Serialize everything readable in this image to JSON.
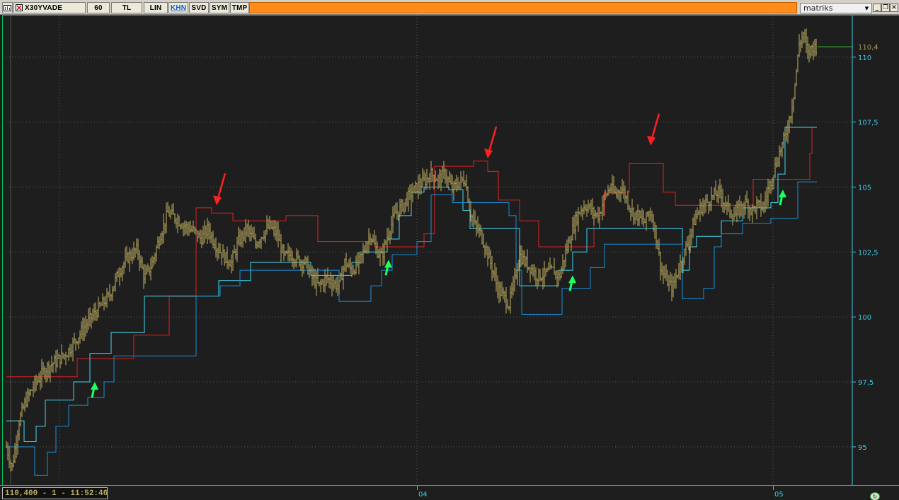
{
  "toolbar": {
    "menu_icon": "chart-menu-icon",
    "symbol": "X30YVADE",
    "period": "60",
    "currency": "TL",
    "scale": "LIN",
    "chart_type": "KHN",
    "svd": "SVD",
    "sym": "SYM",
    "tmp": "TMP",
    "brand": "matriks",
    "accent_color": "#ff8c1a",
    "window_buttons": [
      "dropdown-icon",
      "minimize-icon",
      "restore-icon",
      "close-icon"
    ]
  },
  "chart_data": {
    "type": "candlestick",
    "ylim": [
      93.5,
      111.6
    ],
    "yticks": [
      95,
      97.5,
      100,
      102.5,
      105,
      107.5,
      110
    ],
    "ytick_labels": [
      "95",
      "97,5",
      "100",
      "102,5",
      "105",
      "107,5",
      "110"
    ],
    "x_labels": [
      "04",
      "05"
    ],
    "last_price_label": "110,4",
    "last_price": 110.4,
    "series": [
      {
        "color": "#a89a58",
        "points": [
          [
            0,
            95
          ],
          [
            8,
            94.2
          ],
          [
            18,
            96
          ],
          [
            28,
            96.8
          ],
          [
            40,
            97.4
          ],
          [
            55,
            98
          ],
          [
            70,
            98.3
          ],
          [
            85,
            98.6
          ],
          [
            100,
            99.2
          ],
          [
            115,
            99.8
          ],
          [
            130,
            100.3
          ],
          [
            145,
            100.8
          ],
          [
            160,
            101.8
          ],
          [
            172,
            102.3
          ],
          [
            185,
            102.6
          ],
          [
            195,
            101.5
          ],
          [
            205,
            102
          ],
          [
            218,
            103.2
          ],
          [
            228,
            104
          ],
          [
            240,
            103.8
          ],
          [
            252,
            103.5
          ],
          [
            265,
            103.3
          ],
          [
            275,
            103
          ],
          [
            285,
            103.4
          ],
          [
            295,
            102.8
          ],
          [
            308,
            102.3
          ],
          [
            318,
            102.1
          ],
          [
            328,
            102.9
          ],
          [
            340,
            103.4
          ],
          [
            352,
            102.8
          ],
          [
            362,
            103.2
          ],
          [
            372,
            103.5
          ],
          [
            382,
            103.2
          ],
          [
            392,
            102.3
          ],
          [
            402,
            102.4
          ],
          [
            412,
            102.2
          ],
          [
            422,
            102.1
          ],
          [
            432,
            101.5
          ],
          [
            442,
            101.2
          ],
          [
            452,
            101.5
          ],
          [
            462,
            101.3
          ],
          [
            470,
            101.2
          ],
          [
            478,
            102.1
          ],
          [
            488,
            101.8
          ],
          [
            498,
            102.1
          ],
          [
            506,
            102.6
          ],
          [
            514,
            103.2
          ],
          [
            522,
            102.6
          ],
          [
            530,
            102.3
          ],
          [
            540,
            103.3
          ],
          [
            550,
            104
          ],
          [
            560,
            104.3
          ],
          [
            570,
            104.7
          ],
          [
            580,
            105
          ],
          [
            590,
            105.2
          ],
          [
            600,
            105.5
          ],
          [
            610,
            105.3
          ],
          [
            620,
            105.5
          ],
          [
            630,
            104.9
          ],
          [
            640,
            105.2
          ],
          [
            648,
            105.3
          ],
          [
            655,
            104.1
          ],
          [
            662,
            103.5
          ],
          [
            670,
            103.2
          ],
          [
            678,
            102.6
          ],
          [
            686,
            101.9
          ],
          [
            694,
            101.1
          ],
          [
            702,
            100.8
          ],
          [
            710,
            100.5
          ],
          [
            718,
            101.4
          ],
          [
            725,
            102.4
          ],
          [
            733,
            102.1
          ],
          [
            741,
            101.9
          ],
          [
            749,
            101.6
          ],
          [
            757,
            101.6
          ],
          [
            765,
            101.7
          ],
          [
            773,
            101.8
          ],
          [
            781,
            101.5
          ],
          [
            789,
            102.4
          ],
          [
            797,
            103.1
          ],
          [
            805,
            103.8
          ],
          [
            813,
            104.2
          ],
          [
            821,
            104.3
          ],
          [
            829,
            104
          ],
          [
            837,
            103.9
          ],
          [
            845,
            104.6
          ],
          [
            853,
            105
          ],
          [
            861,
            104.7
          ],
          [
            869,
            105
          ],
          [
            877,
            104.5
          ],
          [
            885,
            104
          ],
          [
            893,
            103.9
          ],
          [
            901,
            103.6
          ],
          [
            909,
            104.1
          ],
          [
            917,
            103.3
          ],
          [
            925,
            101.8
          ],
          [
            933,
            101.4
          ],
          [
            941,
            101.1
          ],
          [
            949,
            101.8
          ],
          [
            957,
            102.4
          ],
          [
            965,
            103.1
          ],
          [
            973,
            103.8
          ],
          [
            981,
            104.2
          ],
          [
            989,
            104.4
          ],
          [
            997,
            104.6
          ],
          [
            1005,
            104.8
          ],
          [
            1013,
            104.5
          ],
          [
            1021,
            104.1
          ],
          [
            1029,
            103.9
          ],
          [
            1037,
            104.2
          ],
          [
            1045,
            104.4
          ],
          [
            1053,
            104.1
          ],
          [
            1061,
            104.3
          ],
          [
            1069,
            104.2
          ],
          [
            1077,
            105
          ],
          [
            1085,
            105.7
          ],
          [
            1093,
            106.4
          ],
          [
            1101,
            107
          ],
          [
            1109,
            108
          ],
          [
            1115,
            109.2
          ],
          [
            1120,
            110.5
          ],
          [
            1126,
            110.9
          ],
          [
            1132,
            110.1
          ],
          [
            1138,
            110.4
          ],
          [
            1144,
            110.4
          ]
        ]
      },
      {
        "color": "#e02020",
        "points": [
          [
            0,
            97.7
          ],
          [
            100,
            97.7
          ],
          [
            100,
            98.4
          ],
          [
            180,
            98.4
          ],
          [
            180,
            99.3
          ],
          [
            230,
            99.3
          ],
          [
            230,
            100.8
          ],
          [
            268,
            100.8
          ],
          [
            268,
            104.2
          ],
          [
            290,
            104.2
          ],
          [
            290,
            104
          ],
          [
            320,
            104
          ],
          [
            320,
            103.7
          ],
          [
            395,
            103.7
          ],
          [
            395,
            103.9
          ],
          [
            440,
            103.9
          ],
          [
            440,
            102.9
          ],
          [
            520,
            102.9
          ],
          [
            520,
            102.7
          ],
          [
            590,
            102.7
          ],
          [
            590,
            103.2
          ],
          [
            605,
            103.2
          ],
          [
            605,
            105.8
          ],
          [
            660,
            105.8
          ],
          [
            660,
            106
          ],
          [
            680,
            106
          ],
          [
            680,
            105.6
          ],
          [
            695,
            105.6
          ],
          [
            695,
            104.5
          ],
          [
            725,
            104.5
          ],
          [
            725,
            103.7
          ],
          [
            752,
            103.7
          ],
          [
            752,
            102.7
          ],
          [
            830,
            102.7
          ],
          [
            830,
            103.9
          ],
          [
            845,
            103.9
          ],
          [
            845,
            104.8
          ],
          [
            880,
            104.8
          ],
          [
            880,
            105.9
          ],
          [
            928,
            105.9
          ],
          [
            928,
            104.8
          ],
          [
            945,
            104.8
          ],
          [
            945,
            104.3
          ],
          [
            1055,
            104.3
          ],
          [
            1055,
            105.3
          ],
          [
            1135,
            105.3
          ],
          [
            1135,
            106.3
          ],
          [
            1138,
            106.3
          ],
          [
            1138,
            107.3
          ]
        ]
      },
      {
        "color": "#40d8f0",
        "points": [
          [
            0,
            96
          ],
          [
            25,
            96
          ],
          [
            25,
            95.2
          ],
          [
            42,
            95.2
          ],
          [
            42,
            95.8
          ],
          [
            55,
            95.8
          ],
          [
            55,
            96.8
          ],
          [
            95,
            96.8
          ],
          [
            95,
            97.5
          ],
          [
            118,
            97.5
          ],
          [
            118,
            98.6
          ],
          [
            148,
            98.6
          ],
          [
            148,
            99.4
          ],
          [
            195,
            99.4
          ],
          [
            195,
            100.8
          ],
          [
            300,
            100.8
          ],
          [
            300,
            101.4
          ],
          [
            345,
            101.4
          ],
          [
            345,
            102.1
          ],
          [
            430,
            102.1
          ],
          [
            430,
            101.6
          ],
          [
            488,
            101.6
          ],
          [
            488,
            102.1
          ],
          [
            500,
            102.1
          ],
          [
            500,
            102.5
          ],
          [
            538,
            102.5
          ],
          [
            538,
            103
          ],
          [
            555,
            103
          ],
          [
            555,
            103.9
          ],
          [
            572,
            103.9
          ],
          [
            572,
            104.8
          ],
          [
            590,
            104.8
          ],
          [
            590,
            105
          ],
          [
            625,
            105
          ],
          [
            625,
            104.9
          ],
          [
            645,
            104.9
          ],
          [
            645,
            104.1
          ],
          [
            655,
            104.1
          ],
          [
            655,
            103.4
          ],
          [
            725,
            103.4
          ],
          [
            725,
            101.2
          ],
          [
            780,
            101.2
          ],
          [
            780,
            101.8
          ],
          [
            800,
            101.8
          ],
          [
            800,
            102.5
          ],
          [
            820,
            102.5
          ],
          [
            820,
            103.4
          ],
          [
            955,
            103.4
          ],
          [
            955,
            101.8
          ],
          [
            965,
            101.8
          ],
          [
            965,
            102.7
          ],
          [
            975,
            102.7
          ],
          [
            975,
            103.1
          ],
          [
            1010,
            103.1
          ],
          [
            1010,
            103.7
          ],
          [
            1040,
            103.7
          ],
          [
            1040,
            104.2
          ],
          [
            1080,
            104.2
          ],
          [
            1080,
            104.4
          ],
          [
            1090,
            104.4
          ],
          [
            1090,
            105.5
          ],
          [
            1100,
            105.5
          ],
          [
            1100,
            107.3
          ],
          [
            1145,
            107.3
          ]
        ]
      },
      {
        "color": "#1890d8",
        "points": [
          [
            0,
            95
          ],
          [
            40,
            95
          ],
          [
            40,
            93.9
          ],
          [
            58,
            93.9
          ],
          [
            58,
            94.8
          ],
          [
            70,
            94.8
          ],
          [
            70,
            95.8
          ],
          [
            88,
            95.8
          ],
          [
            88,
            96.6
          ],
          [
            115,
            96.6
          ],
          [
            115,
            96.9
          ],
          [
            138,
            96.9
          ],
          [
            138,
            97.5
          ],
          [
            152,
            97.5
          ],
          [
            152,
            98.5
          ],
          [
            268,
            98.5
          ],
          [
            268,
            100.8
          ],
          [
            302,
            100.8
          ],
          [
            302,
            101.2
          ],
          [
            330,
            101.2
          ],
          [
            330,
            101.8
          ],
          [
            470,
            101.8
          ],
          [
            470,
            100.6
          ],
          [
            515,
            100.6
          ],
          [
            515,
            101.2
          ],
          [
            530,
            101.2
          ],
          [
            530,
            101.8
          ],
          [
            545,
            101.8
          ],
          [
            545,
            102.4
          ],
          [
            580,
            102.4
          ],
          [
            580,
            102.9
          ],
          [
            600,
            102.9
          ],
          [
            600,
            104.7
          ],
          [
            630,
            104.7
          ],
          [
            630,
            104.4
          ],
          [
            710,
            104.4
          ],
          [
            710,
            103.9
          ],
          [
            720,
            103.9
          ],
          [
            720,
            101.8
          ],
          [
            728,
            101.8
          ],
          [
            728,
            100.1
          ],
          [
            785,
            100.1
          ],
          [
            785,
            101.1
          ],
          [
            825,
            101.1
          ],
          [
            825,
            101.9
          ],
          [
            845,
            101.9
          ],
          [
            845,
            102.8
          ],
          [
            955,
            102.8
          ],
          [
            955,
            100.7
          ],
          [
            985,
            100.7
          ],
          [
            985,
            101.1
          ],
          [
            1000,
            101.1
          ],
          [
            1000,
            102.7
          ],
          [
            1010,
            102.7
          ],
          [
            1010,
            103.2
          ],
          [
            1040,
            103.2
          ],
          [
            1040,
            103.6
          ],
          [
            1080,
            103.6
          ],
          [
            1080,
            103.8
          ],
          [
            1118,
            103.8
          ],
          [
            1118,
            105.2
          ],
          [
            1145,
            105.2
          ]
        ]
      }
    ],
    "annotations": [
      {
        "kind": "arrow-down",
        "color": "#ff2020"
      },
      {
        "kind": "arrow-down",
        "color": "#ff2020"
      },
      {
        "kind": "arrow-down",
        "color": "#ff2020"
      },
      {
        "kind": "arrow-up",
        "color": "#20ff60"
      },
      {
        "kind": "arrow-up",
        "color": "#20ff60"
      },
      {
        "kind": "arrow-up",
        "color": "#20ff60"
      },
      {
        "kind": "arrow-up",
        "color": "#20ff60"
      }
    ]
  },
  "status": {
    "readout": "110,400 - 1 - 11:52:46"
  }
}
